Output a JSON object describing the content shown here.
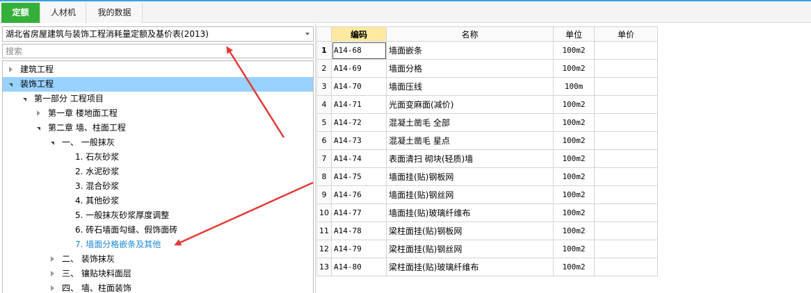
{
  "tabs": [
    {
      "label": "定额",
      "active": true
    },
    {
      "label": "人材机",
      "active": false
    },
    {
      "label": "我的数据",
      "active": false
    }
  ],
  "library_select": {
    "value": "湖北省房屋建筑与装饰工程消耗量定额及基价表(2013)"
  },
  "search": {
    "placeholder": "搜索",
    "value": ""
  },
  "tree": [
    {
      "label": "建筑工程",
      "state": "collapsed"
    },
    {
      "label": "装饰工程",
      "state": "expanded",
      "selected": true
    },
    {
      "label": "第一部分 工程项目",
      "state": "expanded"
    },
    {
      "label": "第一章 楼地面工程",
      "state": "collapsed"
    },
    {
      "label": "第二章 墙、柱面工程",
      "state": "expanded"
    },
    {
      "label": "一、 一般抹灰",
      "state": "expanded"
    },
    {
      "label": "1. 石灰砂浆",
      "state": "leaf"
    },
    {
      "label": "2. 水泥砂浆",
      "state": "leaf"
    },
    {
      "label": "3. 混合砂浆",
      "state": "leaf"
    },
    {
      "label": "4. 其他砂浆",
      "state": "leaf"
    },
    {
      "label": "5. 一般抹灰砂浆厚度调整",
      "state": "leaf"
    },
    {
      "label": "6. 砖石墙面勾缝、假饰面砖",
      "state": "leaf"
    },
    {
      "label": "7. 墙面分格嵌条及其他",
      "state": "leaf",
      "highlight": true
    },
    {
      "label": "二、 装饰抹灰",
      "state": "collapsed"
    },
    {
      "label": "三、 镶贴块料面层",
      "state": "collapsed"
    },
    {
      "label": "四、 墙、柱面装饰",
      "state": "collapsed"
    }
  ],
  "table": {
    "headers": {
      "code": "编码",
      "name": "名称",
      "unit": "单位",
      "price": "单价"
    },
    "rows": [
      {
        "no": "1",
        "code": "A14-68",
        "name": "墙面嵌条",
        "unit": "100m2",
        "price": ""
      },
      {
        "no": "2",
        "code": "A14-69",
        "name": "墙面分格",
        "unit": "100m2",
        "price": ""
      },
      {
        "no": "3",
        "code": "A14-70",
        "name": "墙面压线",
        "unit": "100m",
        "price": ""
      },
      {
        "no": "4",
        "code": "A14-71",
        "name": "光面变麻面(减价)",
        "unit": "100m2",
        "price": ""
      },
      {
        "no": "5",
        "code": "A14-72",
        "name": "混凝土凿毛 全部",
        "unit": "100m2",
        "price": ""
      },
      {
        "no": "6",
        "code": "A14-73",
        "name": "混凝土凿毛 星点",
        "unit": "100m2",
        "price": ""
      },
      {
        "no": "7",
        "code": "A14-74",
        "name": "表面清扫 砌块(轻质)墙",
        "unit": "100m2",
        "price": ""
      },
      {
        "no": "8",
        "code": "A14-75",
        "name": "墙面挂(贴)钢板网",
        "unit": "100m2",
        "price": ""
      },
      {
        "no": "9",
        "code": "A14-76",
        "name": "墙面挂(贴)钢丝网",
        "unit": "100m2",
        "price": ""
      },
      {
        "no": "10",
        "code": "A14-77",
        "name": "墙面挂(贴)玻璃纤维布",
        "unit": "100m2",
        "price": ""
      },
      {
        "no": "11",
        "code": "A14-78",
        "name": "梁柱面挂(贴)钢板网",
        "unit": "100m2",
        "price": ""
      },
      {
        "no": "12",
        "code": "A14-79",
        "name": "梁柱面挂(贴)钢丝网",
        "unit": "100m2",
        "price": ""
      },
      {
        "no": "13",
        "code": "A14-80",
        "name": "梁柱面挂(贴)玻璃纤维布",
        "unit": "100m2",
        "price": ""
      }
    ]
  },
  "colors": {
    "active_tab": "#34b03a",
    "selection": "#99d1ff",
    "annotation_arrow": "#e53935",
    "highlight_text": "#1a8ad8",
    "header_code": "#fdeaa0"
  }
}
